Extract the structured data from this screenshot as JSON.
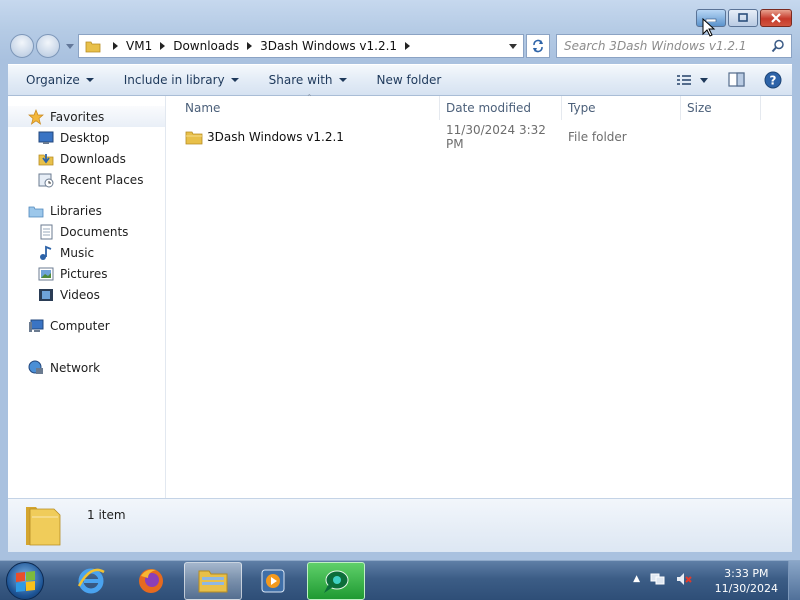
{
  "window": {
    "caption": {
      "minimize": "minimize",
      "maximize": "maximize",
      "close": "close"
    }
  },
  "address": {
    "crumbs": [
      "VM1",
      "Downloads",
      "3Dash Windows v1.2.1"
    ]
  },
  "search": {
    "placeholder": "Search 3Dash Windows v1.2.1"
  },
  "toolbar": {
    "organize": "Organize",
    "include_in_library": "Include in library",
    "share_with": "Share with",
    "new_folder": "New folder"
  },
  "navpane": {
    "favorites": {
      "label": "Favorites",
      "items": [
        "Desktop",
        "Downloads",
        "Recent Places"
      ]
    },
    "libraries": {
      "label": "Libraries",
      "items": [
        "Documents",
        "Music",
        "Pictures",
        "Videos"
      ]
    },
    "computer": "Computer",
    "network": "Network"
  },
  "columns": {
    "name": "Name",
    "date": "Date modified",
    "type": "Type",
    "size": "Size"
  },
  "files": [
    {
      "name": "3Dash Windows v1.2.1",
      "date": "11/30/2024 3:32 PM",
      "type": "File folder",
      "size": ""
    }
  ],
  "details": {
    "count": "1 item"
  },
  "taskbar": {
    "clock_time": "3:33 PM",
    "clock_date": "11/30/2024",
    "apps": [
      "internet-explorer",
      "firefox",
      "windows-explorer",
      "media-player",
      "green-app"
    ]
  },
  "colors": {
    "folder": "#e8c04a",
    "accent": "#2d63a8",
    "close": "#c6392a"
  }
}
